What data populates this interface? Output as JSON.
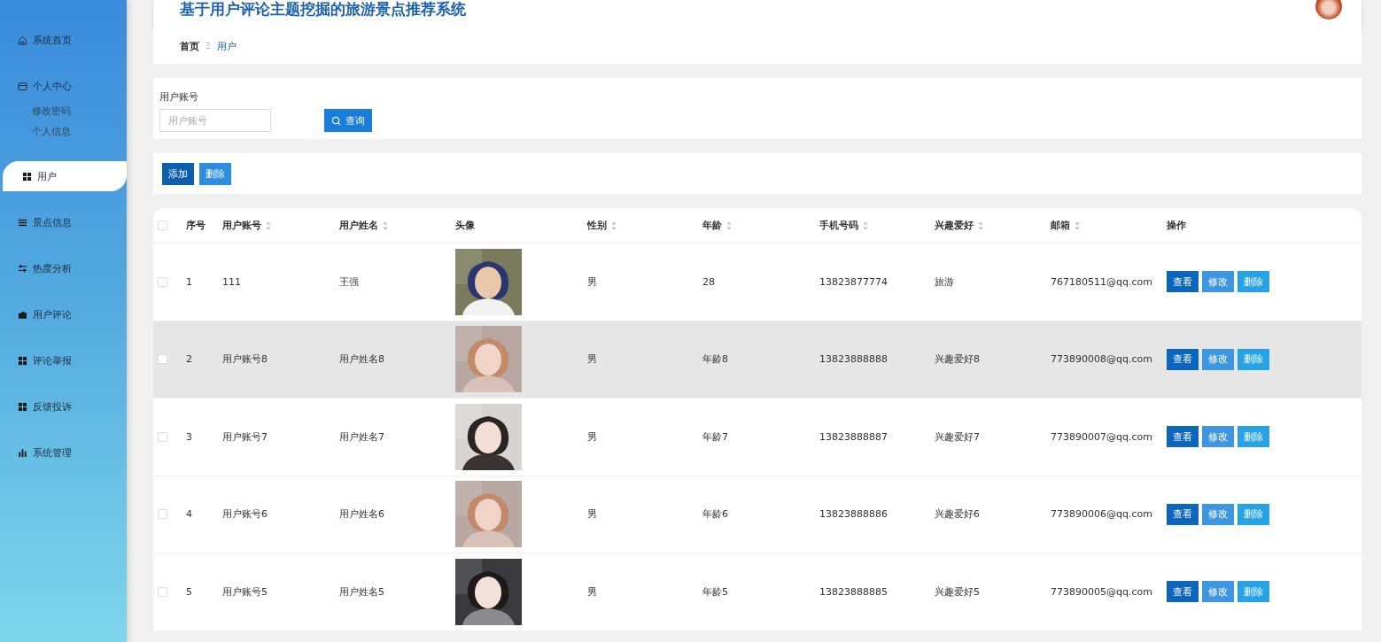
{
  "header": {
    "title": "基于用户评论主题挖掘的旅游景点推荐系统"
  },
  "sidebar": {
    "items": [
      {
        "label": "系统首页",
        "selected": false
      },
      {
        "label": "个人中心",
        "selected": false,
        "children": [
          {
            "label": "修改密码"
          },
          {
            "label": "个人信息"
          }
        ]
      },
      {
        "label": "用户",
        "selected": true
      },
      {
        "label": "景点信息",
        "selected": false
      },
      {
        "label": "热度分析",
        "selected": false
      },
      {
        "label": "用户评论",
        "selected": false
      },
      {
        "label": "评论举报",
        "selected": false
      },
      {
        "label": "反馈投诉",
        "selected": false
      },
      {
        "label": "系统管理",
        "selected": false
      }
    ]
  },
  "breadcrumb": {
    "home": "首页",
    "separator": "Ξ",
    "current": "用户"
  },
  "search": {
    "label": "用户账号",
    "placeholder": "用户账号",
    "button": "查询"
  },
  "toolbar": {
    "add": "添加",
    "delete": "删除"
  },
  "table": {
    "select_all": {
      "checked": false
    },
    "columns": [
      {
        "label": "序号",
        "sortable": false
      },
      {
        "label": "用户账号",
        "sortable": true
      },
      {
        "label": "用户姓名",
        "sortable": true
      },
      {
        "label": "头像",
        "sortable": false
      },
      {
        "label": "性别",
        "sortable": true
      },
      {
        "label": "年龄",
        "sortable": true
      },
      {
        "label": "手机号码",
        "sortable": true
      },
      {
        "label": "兴趣爱好",
        "sortable": true
      },
      {
        "label": "邮箱",
        "sortable": true
      },
      {
        "label": "操作",
        "sortable": false
      }
    ],
    "rows": [
      {
        "checked": false,
        "highlighted": false,
        "cells": [
          "1",
          "111",
          "王强",
          {
            "kind": "picture"
          },
          "男",
          "28",
          "13823877774",
          "旅游",
          "767180511@qq.com",
          {
            "kind": "actions",
            "buttons": [
              "查看",
              "修改",
              "删除"
            ]
          }
        ]
      },
      {
        "checked": false,
        "highlighted": true,
        "cells": [
          "2",
          "用户账号8",
          "用户姓名8",
          {
            "kind": "picture"
          },
          "男",
          "年龄8",
          "13823888888",
          "兴趣爱好8",
          "773890008@qq.com",
          {
            "kind": "actions",
            "buttons": [
              "查看",
              "修改",
              "删除"
            ]
          }
        ]
      },
      {
        "checked": false,
        "highlighted": false,
        "cells": [
          "3",
          "用户账号7",
          "用户姓名7",
          {
            "kind": "picture"
          },
          "男",
          "年龄7",
          "13823888887",
          "兴趣爱好7",
          "773890007@qq.com",
          {
            "kind": "actions",
            "buttons": [
              "查看",
              "修改",
              "删除"
            ]
          }
        ]
      },
      {
        "checked": false,
        "highlighted": false,
        "cells": [
          "4",
          "用户账号6",
          "用户姓名6",
          {
            "kind": "picture"
          },
          "男",
          "年龄6",
          "13823888886",
          "兴趣爱好6",
          "773890006@qq.com",
          {
            "kind": "actions",
            "buttons": [
              "查看",
              "修改",
              "删除"
            ]
          }
        ]
      },
      {
        "checked": false,
        "highlighted": false,
        "cells": [
          "5",
          "用户账号5",
          "用户姓名5",
          {
            "kind": "picture"
          },
          "男",
          "年龄5",
          "13823888885",
          "兴趣爱好5",
          "773890005@qq.com",
          {
            "kind": "actions",
            "buttons": [
              "查看",
              "修改",
              "删除"
            ]
          }
        ]
      }
    ]
  }
}
